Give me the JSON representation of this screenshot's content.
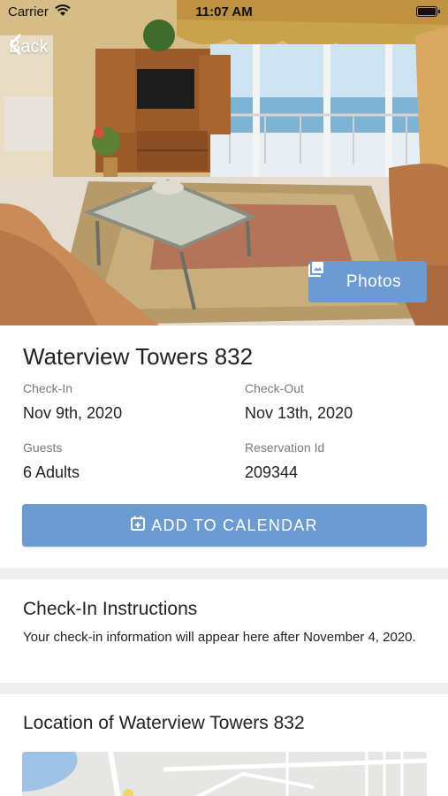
{
  "status_bar": {
    "carrier": "Carrier",
    "time": "11:07 AM"
  },
  "nav": {
    "back_label": "Back"
  },
  "hero": {
    "photos_label": "Photos"
  },
  "reservation": {
    "property_name": "Waterview Towers 832",
    "check_in_label": "Check-In",
    "check_in_value": "Nov 9th, 2020",
    "check_out_label": "Check-Out",
    "check_out_value": "Nov 13th, 2020",
    "guests_label": "Guests",
    "guests_value": "6 Adults",
    "reservation_id_label": "Reservation Id",
    "reservation_id_value": "209344",
    "add_to_calendar_label": "ADD TO CALENDAR"
  },
  "check_in_instructions": {
    "title": "Check-In Instructions",
    "body": "Your check-in information will appear here after November 4, 2020."
  },
  "location": {
    "title": "Location of Waterview Towers 832"
  },
  "colors": {
    "accent": "#6c9bd1",
    "divider": "#efefef",
    "label": "#7a7a7a"
  }
}
